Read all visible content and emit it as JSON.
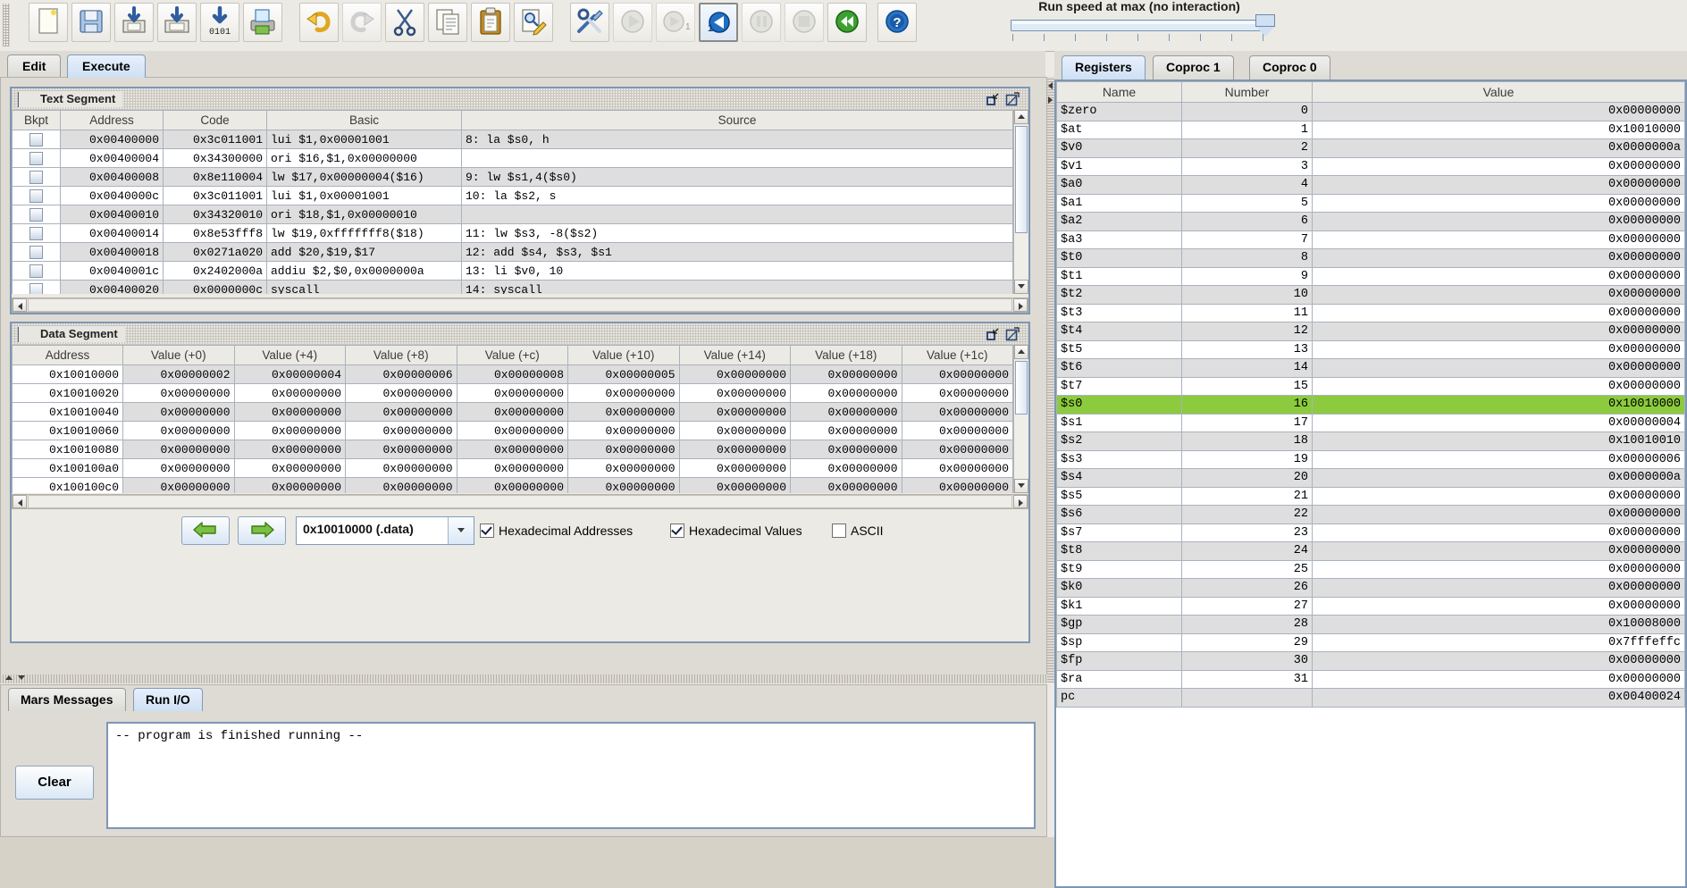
{
  "toolbar": {
    "buttons": [
      {
        "name": "new-file-button",
        "icon": "new-file-icon",
        "enabled": true
      },
      {
        "name": "open-file-button",
        "icon": "open-folder-icon",
        "enabled": true
      },
      {
        "name": "save-button",
        "icon": "save-icon",
        "enabled": true
      },
      {
        "name": "save-as-button",
        "icon": "save-as-icon",
        "enabled": true
      },
      {
        "name": "dump-memory-button",
        "icon": "dump-memory-icon",
        "enabled": true,
        "label": "0101"
      },
      {
        "name": "print-button",
        "icon": "printer-icon",
        "enabled": true
      },
      {
        "name": "undo-button",
        "icon": "undo-arrow-icon",
        "enabled": true
      },
      {
        "name": "redo-button",
        "icon": "redo-arrow-icon",
        "enabled": false
      },
      {
        "name": "cut-button",
        "icon": "scissors-icon",
        "enabled": true
      },
      {
        "name": "copy-button",
        "icon": "copy-icon",
        "enabled": true
      },
      {
        "name": "paste-button",
        "icon": "clipboard-paste-icon",
        "enabled": true
      },
      {
        "name": "find-replace-button",
        "icon": "find-replace-icon",
        "enabled": true
      },
      {
        "name": "assemble-button",
        "icon": "wrench-screwdriver-icon",
        "enabled": true
      },
      {
        "name": "run-button",
        "icon": "play-icon",
        "enabled": false
      },
      {
        "name": "step-button",
        "icon": "step-forward-icon",
        "enabled": false
      },
      {
        "name": "backstep-button",
        "icon": "step-backward-icon",
        "enabled": true,
        "selected": true
      },
      {
        "name": "pause-button",
        "icon": "pause-icon",
        "enabled": false
      },
      {
        "name": "stop-button",
        "icon": "stop-icon",
        "enabled": false
      },
      {
        "name": "reset-button",
        "icon": "rewind-icon",
        "enabled": true
      },
      {
        "name": "help-button",
        "icon": "question-help-icon",
        "enabled": true
      }
    ],
    "speed": {
      "label": "Run speed at max (no interaction)",
      "ticks": 9
    }
  },
  "main_tabs": [
    {
      "label": "Edit",
      "active": false
    },
    {
      "label": "Execute",
      "active": true
    }
  ],
  "text_segment": {
    "title": "Text Segment",
    "columns": [
      "Bkpt",
      "Address",
      "Code",
      "Basic",
      "Source"
    ],
    "rows": [
      {
        "bkpt": "",
        "address": "0x00400000",
        "code": "0x3c011001",
        "basic": "lui $1,0x00001001",
        "source": " 8: la $s0, h"
      },
      {
        "bkpt": "",
        "address": "0x00400004",
        "code": "0x34300000",
        "basic": "ori $16,$1,0x00000000",
        "source": ""
      },
      {
        "bkpt": "",
        "address": "0x00400008",
        "code": "0x8e110004",
        "basic": "lw $17,0x00000004($16)",
        "source": " 9: lw $s1,4($s0)"
      },
      {
        "bkpt": "",
        "address": "0x0040000c",
        "code": "0x3c011001",
        "basic": "lui $1,0x00001001",
        "source": "10: la $s2, s"
      },
      {
        "bkpt": "",
        "address": "0x00400010",
        "code": "0x34320010",
        "basic": "ori $18,$1,0x00000010",
        "source": ""
      },
      {
        "bkpt": "",
        "address": "0x00400014",
        "code": "0x8e53fff8",
        "basic": "lw $19,0xfffffff8($18)",
        "source": "11: lw $s3, -8($s2)"
      },
      {
        "bkpt": "",
        "address": "0x00400018",
        "code": "0x0271a020",
        "basic": "add $20,$19,$17",
        "source": "12: add $s4, $s3, $s1"
      },
      {
        "bkpt": "",
        "address": "0x0040001c",
        "code": "0x2402000a",
        "basic": "addiu $2,$0,0x0000000a",
        "source": "13: li $v0, 10"
      },
      {
        "bkpt": "",
        "address": "0x00400020",
        "code": "0x0000000c",
        "basic": "syscall",
        "source": "14: syscall"
      }
    ]
  },
  "data_segment": {
    "title": "Data Segment",
    "columns": [
      "Address",
      "Value (+0)",
      "Value (+4)",
      "Value (+8)",
      "Value (+c)",
      "Value (+10)",
      "Value (+14)",
      "Value (+18)",
      "Value (+1c)"
    ],
    "rows": [
      {
        "address": "0x10010000",
        "values": [
          "0x00000002",
          "0x00000004",
          "0x00000006",
          "0x00000008",
          "0x00000005",
          "0x00000000",
          "0x00000000",
          "0x00000000"
        ]
      },
      {
        "address": "0x10010020",
        "values": [
          "0x00000000",
          "0x00000000",
          "0x00000000",
          "0x00000000",
          "0x00000000",
          "0x00000000",
          "0x00000000",
          "0x00000000"
        ]
      },
      {
        "address": "0x10010040",
        "values": [
          "0x00000000",
          "0x00000000",
          "0x00000000",
          "0x00000000",
          "0x00000000",
          "0x00000000",
          "0x00000000",
          "0x00000000"
        ]
      },
      {
        "address": "0x10010060",
        "values": [
          "0x00000000",
          "0x00000000",
          "0x00000000",
          "0x00000000",
          "0x00000000",
          "0x00000000",
          "0x00000000",
          "0x00000000"
        ]
      },
      {
        "address": "0x10010080",
        "values": [
          "0x00000000",
          "0x00000000",
          "0x00000000",
          "0x00000000",
          "0x00000000",
          "0x00000000",
          "0x00000000",
          "0x00000000"
        ]
      },
      {
        "address": "0x100100a0",
        "values": [
          "0x00000000",
          "0x00000000",
          "0x00000000",
          "0x00000000",
          "0x00000000",
          "0x00000000",
          "0x00000000",
          "0x00000000"
        ]
      },
      {
        "address": "0x100100c0",
        "values": [
          "0x00000000",
          "0x00000000",
          "0x00000000",
          "0x00000000",
          "0x00000000",
          "0x00000000",
          "0x00000000",
          "0x00000000"
        ]
      }
    ],
    "controls": {
      "prev_label": "left-arrow",
      "next_label": "right-arrow",
      "selected_segment": "0x10010000 (.data)",
      "hex_addresses": {
        "label": "Hexadecimal Addresses",
        "checked": true
      },
      "hex_values": {
        "label": "Hexadecimal Values",
        "checked": true
      },
      "ascii": {
        "label": "ASCII",
        "checked": false
      }
    }
  },
  "message_pane": {
    "tabs": [
      {
        "label": "Mars Messages",
        "active": false
      },
      {
        "label": "Run I/O",
        "active": true
      }
    ],
    "clear_label": "Clear",
    "console_text": "-- program is finished running --"
  },
  "registers_panel": {
    "tabs": [
      {
        "label": "Registers",
        "active": true
      },
      {
        "label": "Coproc 1",
        "active": false
      },
      {
        "label": "Coproc 0",
        "active": false
      }
    ],
    "columns": [
      "Name",
      "Number",
      "Value"
    ],
    "highlight_color": "#8ccb3e",
    "rows": [
      {
        "name": "$zero",
        "number": "0",
        "value": "0x00000000",
        "highlight": false
      },
      {
        "name": "$at",
        "number": "1",
        "value": "0x10010000",
        "highlight": false
      },
      {
        "name": "$v0",
        "number": "2",
        "value": "0x0000000a",
        "highlight": false
      },
      {
        "name": "$v1",
        "number": "3",
        "value": "0x00000000",
        "highlight": false
      },
      {
        "name": "$a0",
        "number": "4",
        "value": "0x00000000",
        "highlight": false
      },
      {
        "name": "$a1",
        "number": "5",
        "value": "0x00000000",
        "highlight": false
      },
      {
        "name": "$a2",
        "number": "6",
        "value": "0x00000000",
        "highlight": false
      },
      {
        "name": "$a3",
        "number": "7",
        "value": "0x00000000",
        "highlight": false
      },
      {
        "name": "$t0",
        "number": "8",
        "value": "0x00000000",
        "highlight": false
      },
      {
        "name": "$t1",
        "number": "9",
        "value": "0x00000000",
        "highlight": false
      },
      {
        "name": "$t2",
        "number": "10",
        "value": "0x00000000",
        "highlight": false
      },
      {
        "name": "$t3",
        "number": "11",
        "value": "0x00000000",
        "highlight": false
      },
      {
        "name": "$t4",
        "number": "12",
        "value": "0x00000000",
        "highlight": false
      },
      {
        "name": "$t5",
        "number": "13",
        "value": "0x00000000",
        "highlight": false
      },
      {
        "name": "$t6",
        "number": "14",
        "value": "0x00000000",
        "highlight": false
      },
      {
        "name": "$t7",
        "number": "15",
        "value": "0x00000000",
        "highlight": false
      },
      {
        "name": "$s0",
        "number": "16",
        "value": "0x10010000",
        "highlight": true
      },
      {
        "name": "$s1",
        "number": "17",
        "value": "0x00000004",
        "highlight": false
      },
      {
        "name": "$s2",
        "number": "18",
        "value": "0x10010010",
        "highlight": false
      },
      {
        "name": "$s3",
        "number": "19",
        "value": "0x00000006",
        "highlight": false
      },
      {
        "name": "$s4",
        "number": "20",
        "value": "0x0000000a",
        "highlight": false
      },
      {
        "name": "$s5",
        "number": "21",
        "value": "0x00000000",
        "highlight": false
      },
      {
        "name": "$s6",
        "number": "22",
        "value": "0x00000000",
        "highlight": false
      },
      {
        "name": "$s7",
        "number": "23",
        "value": "0x00000000",
        "highlight": false
      },
      {
        "name": "$t8",
        "number": "24",
        "value": "0x00000000",
        "highlight": false
      },
      {
        "name": "$t9",
        "number": "25",
        "value": "0x00000000",
        "highlight": false
      },
      {
        "name": "$k0",
        "number": "26",
        "value": "0x00000000",
        "highlight": false
      },
      {
        "name": "$k1",
        "number": "27",
        "value": "0x00000000",
        "highlight": false
      },
      {
        "name": "$gp",
        "number": "28",
        "value": "0x10008000",
        "highlight": false
      },
      {
        "name": "$sp",
        "number": "29",
        "value": "0x7fffeffc",
        "highlight": false
      },
      {
        "name": "$fp",
        "number": "30",
        "value": "0x00000000",
        "highlight": false
      },
      {
        "name": "$ra",
        "number": "31",
        "value": "0x00000000",
        "highlight": false
      },
      {
        "name": "pc",
        "number": "",
        "value": "0x00400024",
        "highlight": false
      }
    ]
  }
}
